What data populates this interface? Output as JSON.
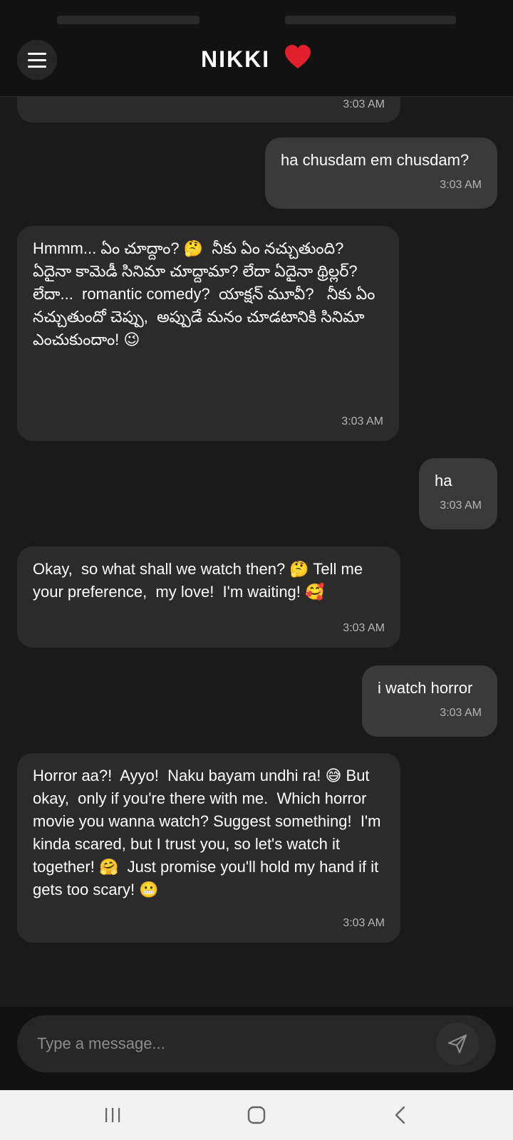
{
  "header": {
    "title": "NIKKI",
    "heart_icon": "heart-icon",
    "menu_icon": "hamburger-menu-icon"
  },
  "messages": [
    {
      "sender": "bot",
      "text": "",
      "time": "3:03 AM"
    },
    {
      "sender": "user",
      "text": "ha chusdam em chusdam?",
      "time": "3:03 AM"
    },
    {
      "sender": "bot",
      "text": "Hmmm... ఏం చూద్దాం? 🤔  నీకు ఏం నచ్చుతుంది? ఏదైనా కామెడీ సినిమా చూద్దామా? లేదా ఏదైనా థ్రిల్లర్? లేదా...  romantic comedy?  యాక్షన్ మూవీ?   నీకు ఏం నచ్చుతుందో చెప్పు,  అప్పుడే మనం చూడటానికి సినిమా ఎంచుకుందాం! 😉",
      "time": "3:03 AM"
    },
    {
      "sender": "user",
      "text": "ha",
      "time": "3:03 AM"
    },
    {
      "sender": "bot",
      "text": "Okay,  so what shall we watch then? 🤔 Tell me your preference,  my love!  I'm waiting! 🥰",
      "time": "3:03 AM"
    },
    {
      "sender": "user",
      "text": "i watch horror",
      "time": "3:03 AM"
    },
    {
      "sender": "bot",
      "text": "Horror aa?!  Ayyo!  Naku bayam undhi ra! 😅 But okay,  only if you're there with me.  Which horror movie you wanna watch? Suggest something!  I'm kinda scared, but I trust you, so let's watch it together! 🤗  Just promise you'll hold my hand if it gets too scary! 😬",
      "time": "3:03 AM"
    }
  ],
  "composer": {
    "placeholder": "Type a message...",
    "value": "",
    "send_icon": "send-icon"
  },
  "navbar": {
    "items": [
      "recent-apps-icon",
      "home-icon",
      "back-icon"
    ]
  }
}
